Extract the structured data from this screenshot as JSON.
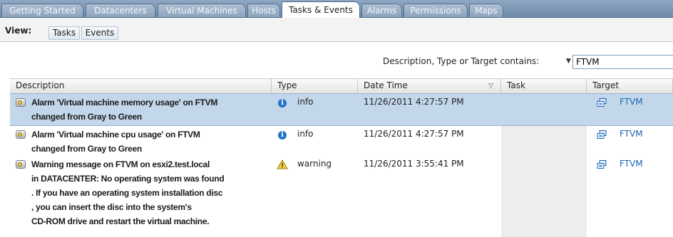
{
  "tabs": [
    {
      "label": "Getting Started",
      "active": false
    },
    {
      "label": "Datacenters",
      "active": false
    },
    {
      "label": "Virtual Machines",
      "active": false
    },
    {
      "label": "Hosts",
      "active": false
    },
    {
      "label": "Tasks & Events",
      "active": true
    },
    {
      "label": "Alarms",
      "active": false
    },
    {
      "label": "Permissions",
      "active": false
    },
    {
      "label": "Maps",
      "active": false
    }
  ],
  "view": {
    "label": "View:",
    "tasks_button": "Tasks",
    "events_button": "Events"
  },
  "filter": {
    "label": "Description, Type or Target contains:",
    "dropdown_icon": "triangle-down",
    "value": "FTVM"
  },
  "columns": {
    "description": "Description",
    "type": "Type",
    "date_time": "Date Time",
    "task": "Task",
    "target": "Target"
  },
  "events": [
    {
      "icon": "alarm-icon",
      "description_lines": [
        "Alarm 'Virtual machine memory usage' on FTVM",
        "changed from Gray to Green"
      ],
      "type_icon": "info-icon",
      "type": "info",
      "date_time": "11/26/2011 4:27:57 PM",
      "task": "",
      "target_icon": "vm-icon",
      "target": "FTVM",
      "selected": true
    },
    {
      "icon": "alarm-icon",
      "description_lines": [
        "Alarm 'Virtual machine cpu usage' on FTVM",
        "changed from Gray to Green"
      ],
      "type_icon": "info-icon",
      "type": "info",
      "date_time": "11/26/2011 4:27:57 PM",
      "task": "",
      "target_icon": "vm-icon",
      "target": "FTVM",
      "selected": false
    },
    {
      "icon": "alarm-icon",
      "description_lines": [
        "Warning message on FTVM on esxi2.test.local",
        "in DATACENTER: No operating system was found",
        ". If you have an operating system installation disc",
        ", you can insert the disc into the system's",
        "CD-ROM drive and restart the virtual machine."
      ],
      "type_icon": "warning-icon",
      "type": "warning",
      "date_time": "11/26/2011 3:55:41 PM",
      "task": "",
      "target_icon": "vm-icon",
      "target": "FTVM",
      "selected": false
    }
  ]
}
